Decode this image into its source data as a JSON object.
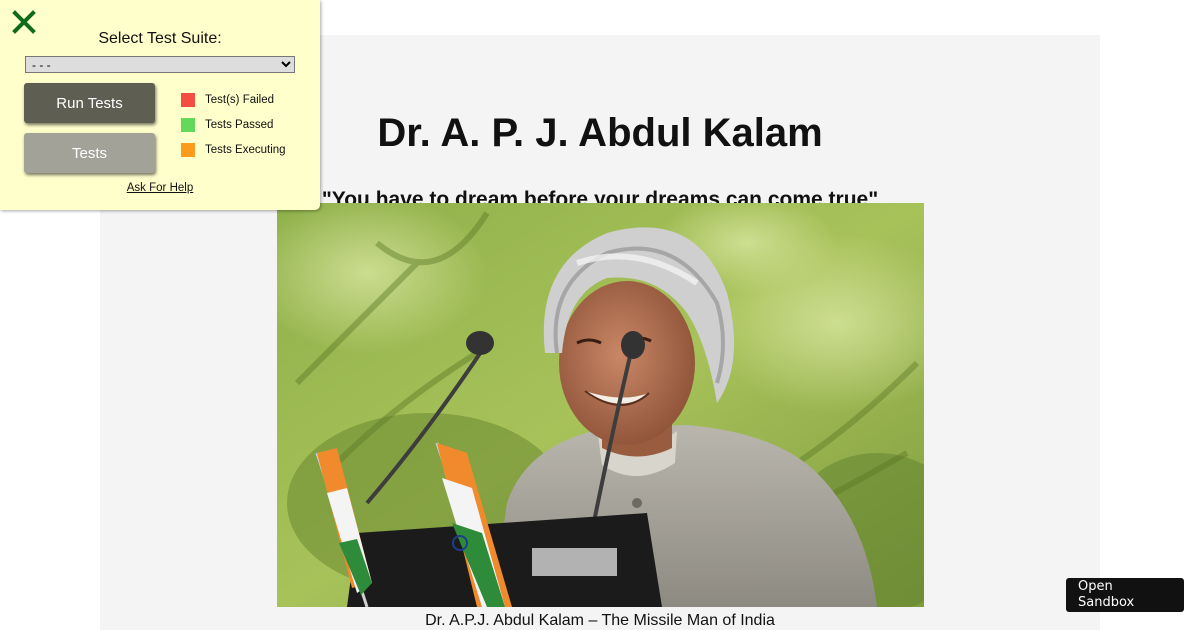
{
  "tribute": {
    "title": "Dr. A. P. J. Abdul Kalam",
    "quote": "\"You have to dream before your dreams can come true\"",
    "caption": "Dr. A.P.J. Abdul Kalam – The Missile Man of India"
  },
  "test_panel": {
    "close_icon": "close-x-icon",
    "select_label": "Select Test Suite:",
    "select_value": "- - -",
    "run_button": "Run Tests",
    "tests_button": "Tests",
    "legend": [
      {
        "label": "Test(s) Failed",
        "color": "#f44e43"
      },
      {
        "label": "Tests Passed",
        "color": "#62d95a"
      },
      {
        "label": "Tests Executing",
        "color": "#fb9a1c"
      }
    ],
    "help_link": "Ask For Help"
  },
  "sandbox": {
    "label": "Open Sandbox"
  },
  "colors": {
    "close_icon": "#0e6b1b",
    "panel_bg": "#ffffcc",
    "page_bg": "#f4f4f4"
  }
}
